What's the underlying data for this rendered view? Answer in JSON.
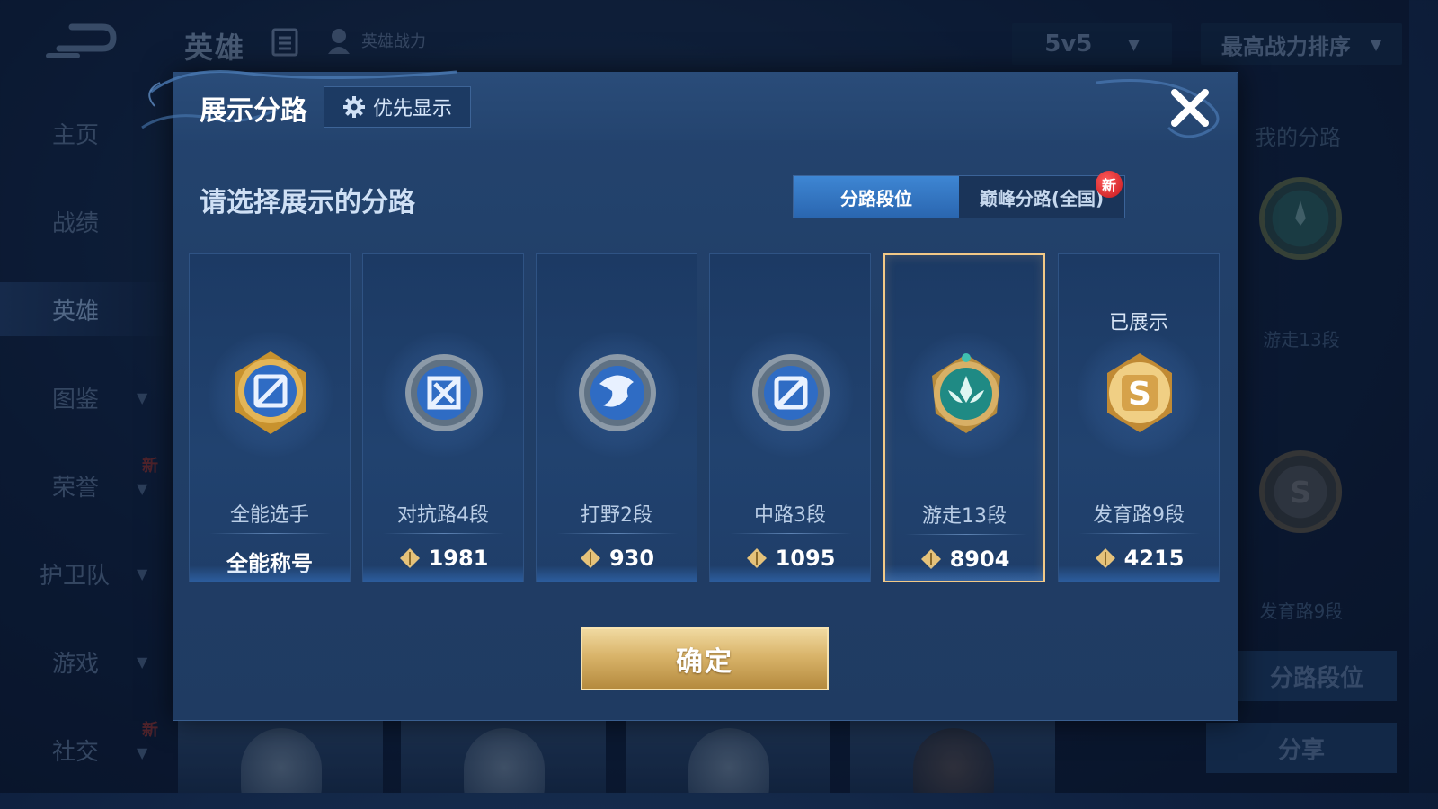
{
  "header": {
    "title": "英雄",
    "power_label": "英雄战力",
    "mode": "5v5",
    "sort": "最高战力排序"
  },
  "sidebar": {
    "items": [
      {
        "label": "主页"
      },
      {
        "label": "战绩"
      },
      {
        "label": "英雄"
      },
      {
        "label": "图鉴"
      },
      {
        "label": "荣誉",
        "badge": "新"
      },
      {
        "label": "护卫队"
      },
      {
        "label": "游戏"
      },
      {
        "label": "社交",
        "badge": "新"
      }
    ]
  },
  "right_panel": {
    "title": "我的分路",
    "lane1": "游走13段",
    "lane2": "发育路9段",
    "btn_rank": "分路段位",
    "btn_share": "分享"
  },
  "dialog": {
    "title": "展示分路",
    "priority_button": "优先显示",
    "prompt": "请选择展示的分路",
    "tabs": [
      {
        "label": "分路段位",
        "active": true
      },
      {
        "label": "巅峰分路(全国)",
        "active": false,
        "badge": "新"
      }
    ],
    "cards": [
      {
        "name": "全能选手",
        "value": "全能称号",
        "badge_icon": "all-round-badge-icon",
        "shown": ""
      },
      {
        "name": "对抗路4段",
        "value": "1981",
        "badge_icon": "clash-lane-badge-icon",
        "shown": ""
      },
      {
        "name": "打野2段",
        "value": "930",
        "badge_icon": "jungle-badge-icon",
        "shown": ""
      },
      {
        "name": "中路3段",
        "value": "1095",
        "badge_icon": "mid-lane-badge-icon",
        "shown": ""
      },
      {
        "name": "游走13段",
        "value": "8904",
        "badge_icon": "roam-badge-icon",
        "shown": "",
        "selected": true
      },
      {
        "name": "发育路9段",
        "value": "4215",
        "badge_icon": "farm-lane-badge-icon",
        "shown": "已展示"
      }
    ],
    "confirm": "确定"
  },
  "colors": {
    "accent_blue": "#2a66b0",
    "gold": "#d9b46a",
    "selected_border": "#f2c987",
    "new_badge": "#c4161c"
  }
}
